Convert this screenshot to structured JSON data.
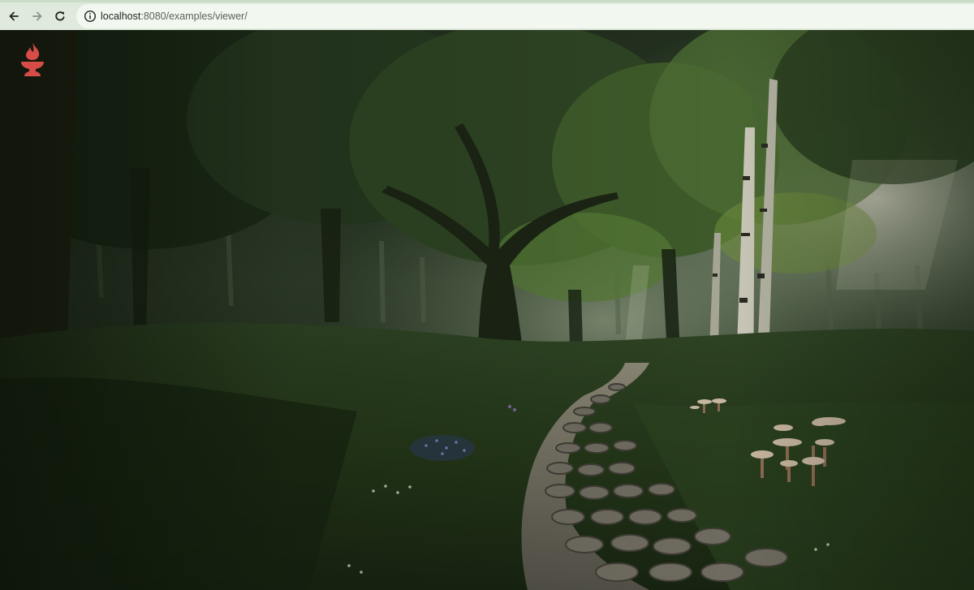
{
  "browser": {
    "url_host": "localhost",
    "url_path": ":8080/examples/viewer/",
    "back_icon": "arrow-left-icon",
    "forward_icon": "arrow-right-icon",
    "reload_icon": "reload-icon",
    "site_info_icon": "info-icon"
  },
  "viewer": {
    "logo_icon": "flame-torch-icon",
    "logo_color": "#d64c46",
    "panorama": "forest-path-scene"
  }
}
